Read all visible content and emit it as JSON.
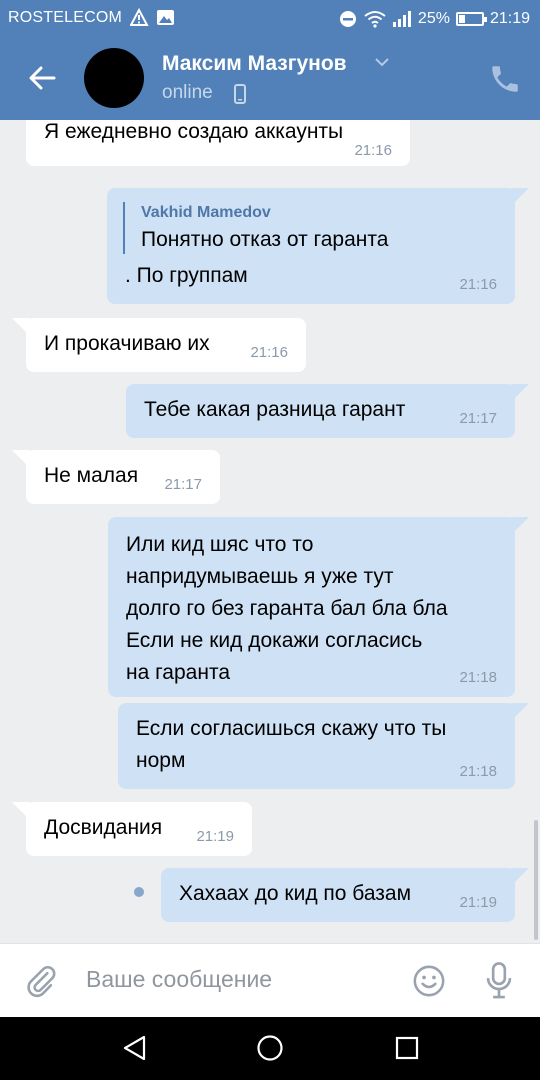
{
  "status_bar": {
    "carrier": "ROSTELECOM",
    "battery": "25%",
    "battery_level": 0.25,
    "time": "21:19"
  },
  "header": {
    "contact_name": "Максим Мазгунов",
    "status": "online",
    "accent_color": "#5181b8"
  },
  "messages": [
    {
      "dir": "in",
      "text": "Я ежедневно создаю аккаунты",
      "time": "21:16"
    },
    {
      "dir": "out",
      "reply_to": {
        "author": "Vakhid Mamedov",
        "text": "Понятно отказ от гаранта"
      },
      "text": ". По группам",
      "time": "21:16"
    },
    {
      "dir": "in",
      "text": "И прокачиваю их",
      "time": "21:16"
    },
    {
      "dir": "out",
      "text": "Тебе какая разница гарант",
      "time": "21:17"
    },
    {
      "dir": "in",
      "text": "Не малая",
      "time": "21:17"
    },
    {
      "dir": "out",
      "lines": [
        "Или кид шяс что то",
        "напридумываешь я уже тут",
        "долго го без гаранта бал бла бла",
        "Если не кид докажи согласись",
        "на гаранта"
      ],
      "time": "21:18"
    },
    {
      "dir": "out",
      "lines": [
        "Если согласишься скажу что ты",
        "норм"
      ],
      "time": "21:18"
    },
    {
      "dir": "in",
      "text": "Досвидания",
      "time": "21:19"
    },
    {
      "dir": "out",
      "text": "Хахаах до кид по базам",
      "time": "21:19",
      "unread": true
    }
  ],
  "composer": {
    "placeholder": "Ваше сообщение",
    "icons": [
      "paperclip-icon",
      "emoji-icon",
      "microphone-icon"
    ]
  },
  "nav_bar": {
    "icons": [
      "back-triangle-icon",
      "home-circle-icon",
      "recents-square-icon"
    ]
  }
}
